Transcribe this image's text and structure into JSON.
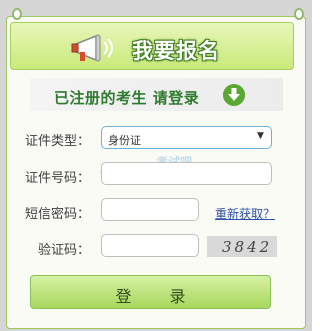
{
  "header": {
    "title": "我要报名"
  },
  "banner": {
    "text": "已注册的考生  请登录"
  },
  "form": {
    "id_type": {
      "label": "证件类型：",
      "value": "身份证"
    },
    "id_number": {
      "label": "证件号码："
    },
    "sms_code": {
      "label": "短信密码：",
      "refresh_link": "重新获取？"
    },
    "captcha": {
      "label": "验证码：",
      "image_text": "3842"
    }
  },
  "watermark": {
    "text": "考试吧",
    "subtext": ".com"
  },
  "submit": {
    "label": "登录"
  },
  "colors": {
    "accent": "#5aa833",
    "link": "#2c4fa7",
    "header_green": "#c9ea7a"
  }
}
